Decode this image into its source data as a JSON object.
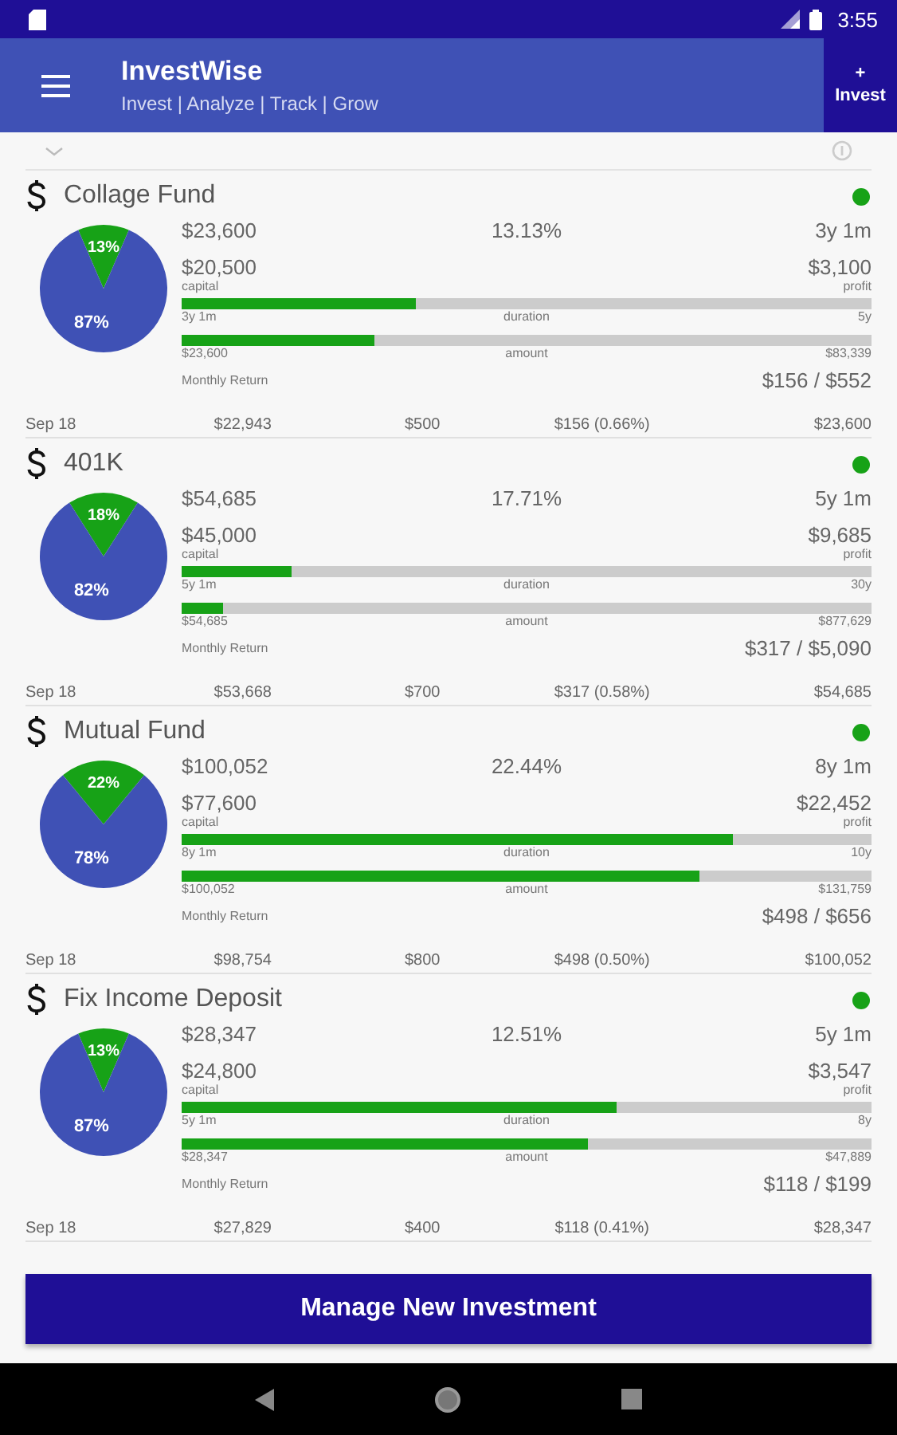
{
  "status_bar": {
    "time": "3:55"
  },
  "app_bar": {
    "title": "InvestWise",
    "subtitle": "Invest | Analyze | Track | Grow",
    "invest_button": {
      "symbol": "+",
      "label": "Invest"
    }
  },
  "investments": [
    {
      "name": "Collage Fund",
      "active": true,
      "value": "$23,600",
      "rate": "13.13%",
      "elapsed": "3y 1m",
      "capital": "$20,500",
      "capital_label": "capital",
      "profit": "$3,100",
      "profit_label": "profit",
      "duration": {
        "level": 0.34,
        "start": "3y 1m",
        "label": "duration",
        "end": "5y"
      },
      "amount": {
        "level": 0.28,
        "start": "$23,600",
        "label": "amount",
        "end": "$83,339"
      },
      "monthly_label": "Monthly Return",
      "monthly": "$156 / $552",
      "footer": [
        "Sep 18",
        "$22,943",
        "$500",
        "$156 (0.66%)",
        "$23,600"
      ],
      "chart_data": {
        "type": "pie",
        "values": [
          13,
          87
        ],
        "value_labels": [
          "13%",
          "87%"
        ]
      }
    },
    {
      "name": "401K",
      "active": true,
      "value": "$54,685",
      "rate": "17.71%",
      "elapsed": "5y 1m",
      "capital": "$45,000",
      "capital_label": "capital",
      "profit": "$9,685",
      "profit_label": "profit",
      "duration": {
        "level": 0.16,
        "start": "5y 1m",
        "label": "duration",
        "end": "30y"
      },
      "amount": {
        "level": 0.06,
        "start": "$54,685",
        "label": "amount",
        "end": "$877,629"
      },
      "monthly_label": "Monthly Return",
      "monthly": "$317 / $5,090",
      "footer": [
        "Sep 18",
        "$53,668",
        "$700",
        "$317 (0.58%)",
        "$54,685"
      ],
      "chart_data": {
        "type": "pie",
        "values": [
          18,
          82
        ],
        "value_labels": [
          "18%",
          "82%"
        ]
      }
    },
    {
      "name": "Mutual Fund",
      "active": true,
      "value": "$100,052",
      "rate": "22.44%",
      "elapsed": "8y 1m",
      "capital": "$77,600",
      "capital_label": "capital",
      "profit": "$22,452",
      "profit_label": "profit",
      "duration": {
        "level": 0.8,
        "start": "8y 1m",
        "label": "duration",
        "end": "10y"
      },
      "amount": {
        "level": 0.75,
        "start": "$100,052",
        "label": "amount",
        "end": "$131,759"
      },
      "monthly_label": "Monthly Return",
      "monthly": "$498 / $656",
      "footer": [
        "Sep 18",
        "$98,754",
        "$800",
        "$498 (0.50%)",
        "$100,052"
      ],
      "chart_data": {
        "type": "pie",
        "values": [
          22,
          78
        ],
        "value_labels": [
          "22%",
          "78%"
        ]
      }
    },
    {
      "name": "Fix Income Deposit",
      "active": true,
      "value": "$28,347",
      "rate": "12.51%",
      "elapsed": "5y 1m",
      "capital": "$24,800",
      "capital_label": "capital",
      "profit": "$3,547",
      "profit_label": "profit",
      "duration": {
        "level": 0.63,
        "start": "5y 1m",
        "label": "duration",
        "end": "8y"
      },
      "amount": {
        "level": 0.59,
        "start": "$28,347",
        "label": "amount",
        "end": "$47,889"
      },
      "monthly_label": "Monthly Return",
      "monthly": "$118 / $199",
      "footer": [
        "Sep 18",
        "$27,829",
        "$400",
        "$118 (0.41%)",
        "$28,347"
      ],
      "chart_data": {
        "type": "pie",
        "values": [
          13,
          87
        ],
        "value_labels": [
          "13%",
          "87%"
        ]
      }
    }
  ],
  "manage_button": "Manage New Investment"
}
